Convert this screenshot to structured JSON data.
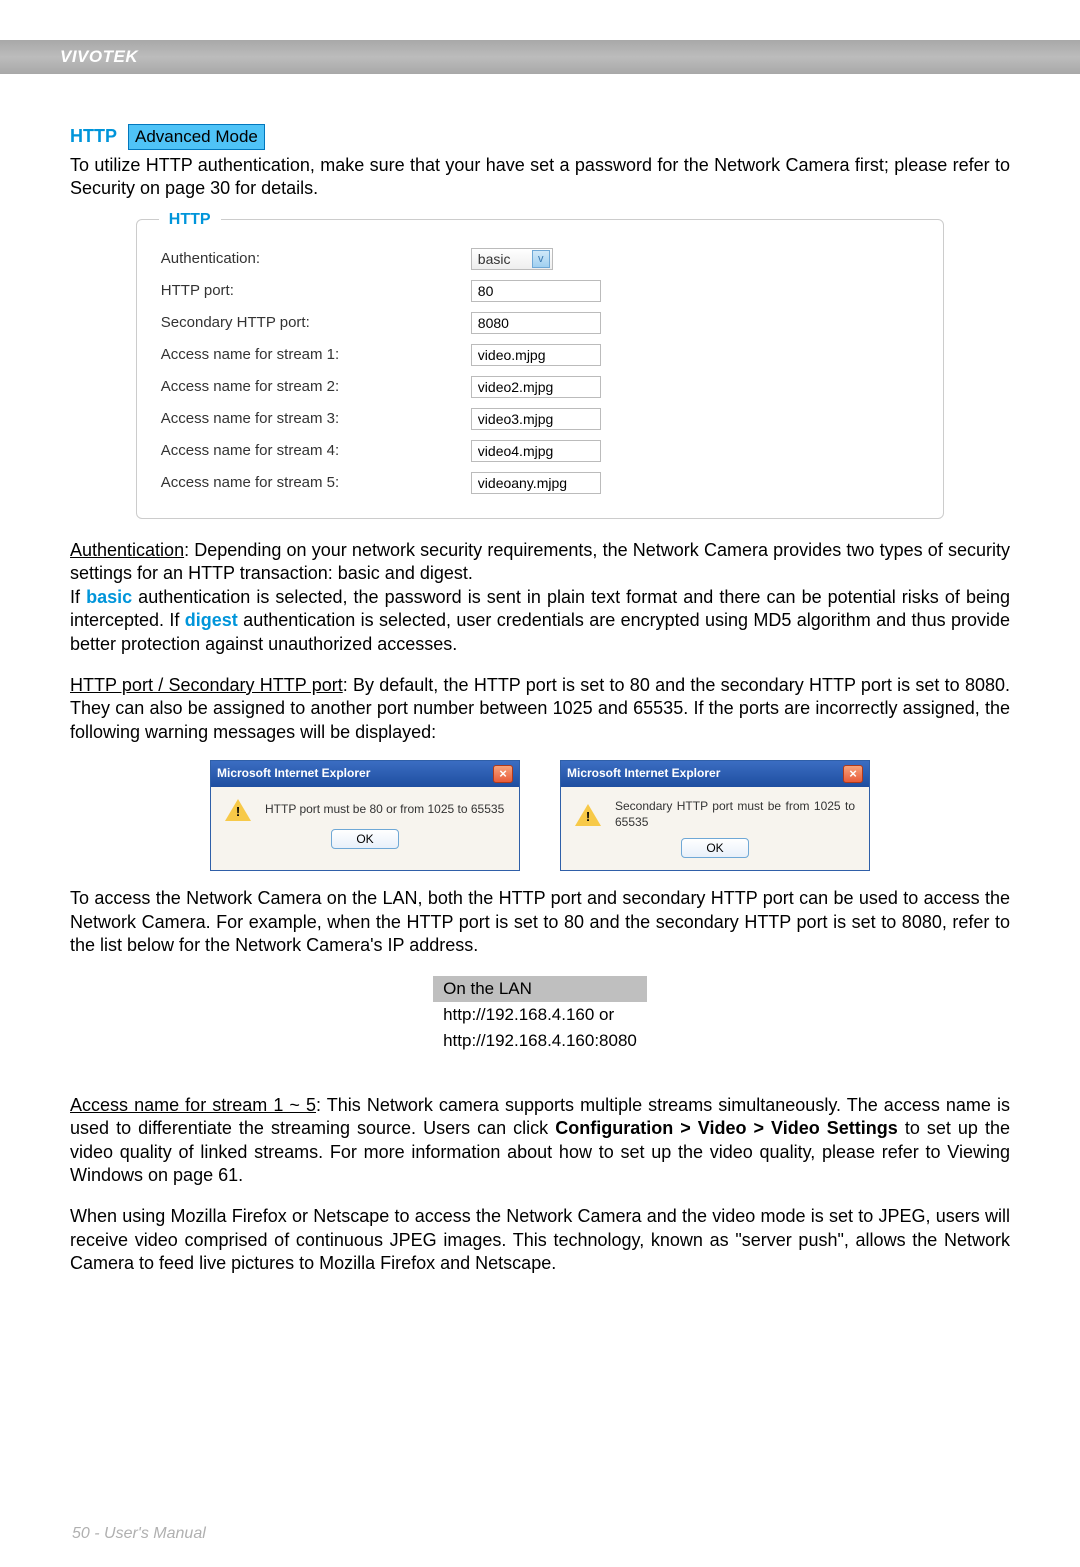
{
  "header": {
    "brand": "VIVOTEK"
  },
  "section": {
    "title": "HTTP",
    "badge": "Advanced Mode",
    "intro": "To utilize HTTP authentication, make sure that your have set a password for the Network Camera first; please refer to Security on page 30 for details."
  },
  "form": {
    "legend": "HTTP",
    "rows": [
      {
        "label": "Authentication:",
        "value": "basic",
        "type": "select"
      },
      {
        "label": "HTTP port:",
        "value": "80",
        "type": "text"
      },
      {
        "label": "Secondary HTTP port:",
        "value": "8080",
        "type": "text"
      },
      {
        "label": "Access name for stream 1:",
        "value": "video.mjpg",
        "type": "text"
      },
      {
        "label": "Access name for stream 2:",
        "value": "video2.mjpg",
        "type": "text"
      },
      {
        "label": "Access name for stream 3:",
        "value": "video3.mjpg",
        "type": "text"
      },
      {
        "label": "Access name for stream 4:",
        "value": "video4.mjpg",
        "type": "text"
      },
      {
        "label": "Access name for stream 5:",
        "value": "videoany.mjpg",
        "type": "text"
      }
    ]
  },
  "body": {
    "auth_label": "Authentication",
    "auth_text1": ": Depending on your network security requirements, the Network Camera provides two types of security settings for an HTTP transaction: basic and digest.",
    "auth_text2a": "If ",
    "auth_basic": "basic",
    "auth_text2b": " authentication is selected, the password is sent in plain text format and there can be potential risks of being intercepted. If ",
    "auth_digest": "digest",
    "auth_text2c": " authentication is selected, user credentials are encrypted using MD5 algorithm and thus provide better protection against unauthorized accesses.",
    "port_label": "HTTP port / Secondary HTTP port",
    "port_text": ": By default, the HTTP port is set to 80 and the secondary HTTP port is set to 8080. They can also be assigned to another port number between 1025 and 65535. If the ports are incorrectly assigned, the following warning messages will be displayed:",
    "after_dialog": "To access the Network Camera on the LAN, both the HTTP port and secondary HTTP port can be used to access the Network Camera. For example, when the HTTP port is set to 80 and the secondary HTTP port is set to 8080, refer to the list below for the Network Camera's IP address.",
    "lan_header": "On the LAN",
    "lan_line1": "http://192.168.4.160  or",
    "lan_line2": "http://192.168.4.160:8080",
    "access_label": "Access name for stream 1 ~ 5",
    "access_text1": ": This Network camera supports multiple streams simultaneously. The access name is used to differentiate the streaming source. Users can click ",
    "access_bold": "Configuration > Video > Video Settings",
    "access_text2": " to set up the video quality of linked streams. For more information about how to set up the video quality, please refer to Viewing Windows on page 61.",
    "firefox": "When using Mozilla Firefox or Netscape to access the Network Camera and the video mode is set to JPEG, users will receive video comprised of continuous JPEG images. This technology, known as \"server push\", allows the Network Camera to feed live pictures to Mozilla Firefox and Netscape."
  },
  "dialogs": {
    "title": "Microsoft Internet Explorer",
    "ok": "OK",
    "msg1": "HTTP port must be 80 or from 1025 to 65535",
    "msg2": "Secondary HTTP port must be from 1025 to 65535"
  },
  "footer": {
    "text": "50 - User's Manual"
  }
}
